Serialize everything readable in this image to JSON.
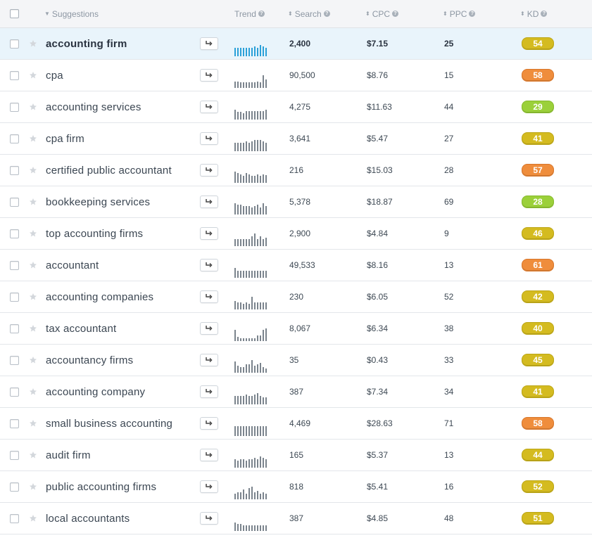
{
  "header": {
    "suggestions": "Suggestions",
    "trend": "Trend",
    "search": "Search",
    "cpc": "CPC",
    "ppc": "PPC",
    "kd": "KD"
  },
  "colors": {
    "kd_easy": "#9bd03a",
    "kd_medium": "#d4bb20",
    "kd_hard": "#ef8d3c",
    "selected_row": "#e9f4fb",
    "trend_selected": "#2aa0d8"
  },
  "rows": [
    {
      "keyword": "accounting firm",
      "search": "2,400",
      "cpc": "$7.15",
      "ppc": "25",
      "kd": "54",
      "kd_level": "mid",
      "selected": true,
      "trend": [
        0.6,
        0.6,
        0.6,
        0.6,
        0.6,
        0.6,
        0.6,
        0.7,
        0.6,
        0.8,
        0.7,
        0.6
      ]
    },
    {
      "keyword": "cpa",
      "search": "90,500",
      "cpc": "$8.76",
      "ppc": "15",
      "kd": "58",
      "kd_level": "hard",
      "trend": [
        0.45,
        0.45,
        0.4,
        0.4,
        0.4,
        0.4,
        0.4,
        0.4,
        0.45,
        0.4,
        0.9,
        0.6
      ]
    },
    {
      "keyword": "accounting services",
      "search": "4,275",
      "cpc": "$11.63",
      "ppc": "44",
      "kd": "29",
      "kd_level": "easy",
      "trend": [
        0.7,
        0.55,
        0.55,
        0.45,
        0.6,
        0.6,
        0.6,
        0.6,
        0.6,
        0.6,
        0.6,
        0.7
      ]
    },
    {
      "keyword": "cpa firm",
      "search": "3,641",
      "cpc": "$5.47",
      "ppc": "27",
      "kd": "41",
      "kd_level": "mid",
      "trend": [
        0.6,
        0.6,
        0.6,
        0.6,
        0.7,
        0.6,
        0.7,
        0.8,
        0.8,
        0.8,
        0.7,
        0.6
      ]
    },
    {
      "keyword": "certified public accountant",
      "search": "216",
      "cpc": "$15.03",
      "ppc": "28",
      "kd": "57",
      "kd_level": "hard",
      "trend": [
        0.8,
        0.7,
        0.6,
        0.5,
        0.7,
        0.6,
        0.5,
        0.5,
        0.6,
        0.5,
        0.6,
        0.55
      ]
    },
    {
      "keyword": "bookkeeping services",
      "search": "5,378",
      "cpc": "$18.87",
      "ppc": "69",
      "kd": "28",
      "kd_level": "easy",
      "trend": [
        0.8,
        0.7,
        0.7,
        0.6,
        0.6,
        0.6,
        0.5,
        0.6,
        0.7,
        0.5,
        0.8,
        0.6
      ]
    },
    {
      "keyword": "top accounting firms",
      "search": "2,900",
      "cpc": "$4.84",
      "ppc": "9",
      "kd": "46",
      "kd_level": "mid",
      "trend": [
        0.5,
        0.5,
        0.5,
        0.5,
        0.5,
        0.5,
        0.7,
        0.9,
        0.5,
        0.7,
        0.5,
        0.6
      ]
    },
    {
      "keyword": "accountant",
      "search": "49,533",
      "cpc": "$8.16",
      "ppc": "13",
      "kd": "61",
      "kd_level": "hard",
      "trend": [
        0.7,
        0.5,
        0.5,
        0.5,
        0.5,
        0.5,
        0.5,
        0.5,
        0.5,
        0.5,
        0.5,
        0.5
      ]
    },
    {
      "keyword": "accounting companies",
      "search": "230",
      "cpc": "$6.05",
      "ppc": "52",
      "kd": "42",
      "kd_level": "mid",
      "trend": [
        0.6,
        0.5,
        0.5,
        0.4,
        0.5,
        0.4,
        0.9,
        0.5,
        0.5,
        0.5,
        0.5,
        0.5
      ]
    },
    {
      "keyword": "tax accountant",
      "search": "8,067",
      "cpc": "$6.34",
      "ppc": "38",
      "kd": "40",
      "kd_level": "mid",
      "trend": [
        0.8,
        0.3,
        0.2,
        0.2,
        0.2,
        0.2,
        0.2,
        0.2,
        0.4,
        0.4,
        0.8,
        0.9
      ]
    },
    {
      "keyword": "accountancy firms",
      "search": "35",
      "cpc": "$0.43",
      "ppc": "33",
      "kd": "45",
      "kd_level": "mid",
      "trend": [
        0.8,
        0.5,
        0.4,
        0.4,
        0.6,
        0.6,
        0.9,
        0.5,
        0.6,
        0.7,
        0.4,
        0.3
      ]
    },
    {
      "keyword": "accounting company",
      "search": "387",
      "cpc": "$7.34",
      "ppc": "34",
      "kd": "41",
      "kd_level": "mid",
      "trend": [
        0.6,
        0.6,
        0.6,
        0.6,
        0.7,
        0.6,
        0.6,
        0.7,
        0.8,
        0.6,
        0.5,
        0.5
      ]
    },
    {
      "keyword": "small business accounting",
      "search": "4,469",
      "cpc": "$28.63",
      "ppc": "71",
      "kd": "58",
      "kd_level": "hard",
      "trend": [
        0.7,
        0.7,
        0.7,
        0.7,
        0.7,
        0.7,
        0.7,
        0.7,
        0.7,
        0.7,
        0.7,
        0.7
      ]
    },
    {
      "keyword": "audit firm",
      "search": "165",
      "cpc": "$5.37",
      "ppc": "13",
      "kd": "44",
      "kd_level": "mid",
      "trend": [
        0.6,
        0.5,
        0.6,
        0.6,
        0.5,
        0.6,
        0.6,
        0.7,
        0.6,
        0.8,
        0.7,
        0.6
      ]
    },
    {
      "keyword": "public accounting firms",
      "search": "818",
      "cpc": "$5.41",
      "ppc": "16",
      "kd": "52",
      "kd_level": "mid",
      "trend": [
        0.4,
        0.5,
        0.5,
        0.7,
        0.4,
        0.8,
        0.9,
        0.5,
        0.6,
        0.4,
        0.5,
        0.4
      ]
    },
    {
      "keyword": "local accountants",
      "search": "387",
      "cpc": "$4.85",
      "ppc": "48",
      "kd": "51",
      "kd_level": "mid",
      "trend": [
        0.6,
        0.5,
        0.5,
        0.4,
        0.4,
        0.4,
        0.4,
        0.4,
        0.4,
        0.4,
        0.4,
        0.4
      ]
    }
  ]
}
